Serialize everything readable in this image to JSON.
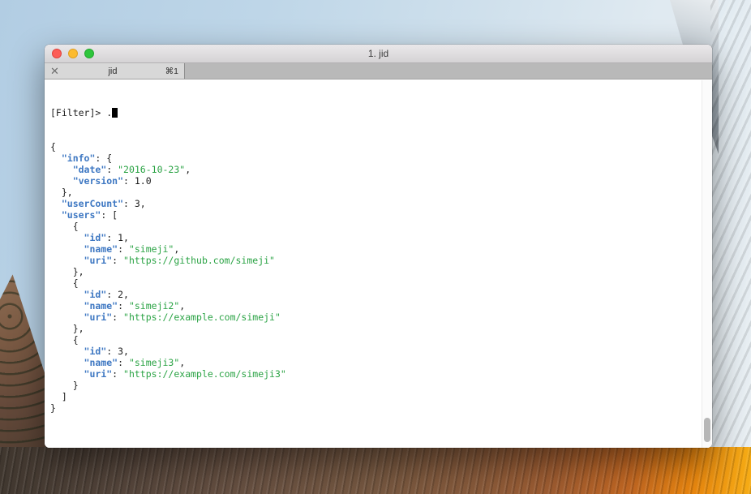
{
  "window": {
    "title": "1. jid",
    "tab": {
      "close_glyph": "✕",
      "title": "jid",
      "shortcut": "⌘1"
    }
  },
  "terminal": {
    "prompt": "[Filter]> ",
    "filter_value": ".",
    "colors": {
      "key": "#3d77c2",
      "string": "#2aa344",
      "plain": "#1c1c1c"
    },
    "json_lines": [
      [
        [
          "p",
          "{"
        ]
      ],
      [
        [
          "p",
          "  "
        ],
        [
          "k",
          "\"info\""
        ],
        [
          "p",
          ": {"
        ]
      ],
      [
        [
          "p",
          "    "
        ],
        [
          "k",
          "\"date\""
        ],
        [
          "p",
          ": "
        ],
        [
          "s",
          "\"2016-10-23\""
        ],
        [
          "p",
          ","
        ]
      ],
      [
        [
          "p",
          "    "
        ],
        [
          "k",
          "\"version\""
        ],
        [
          "p",
          ": 1.0"
        ]
      ],
      [
        [
          "p",
          "  },"
        ]
      ],
      [
        [
          "p",
          "  "
        ],
        [
          "k",
          "\"userCount\""
        ],
        [
          "p",
          ": 3,"
        ]
      ],
      [
        [
          "p",
          "  "
        ],
        [
          "k",
          "\"users\""
        ],
        [
          "p",
          ": ["
        ]
      ],
      [
        [
          "p",
          "    {"
        ]
      ],
      [
        [
          "p",
          "      "
        ],
        [
          "k",
          "\"id\""
        ],
        [
          "p",
          ": 1,"
        ]
      ],
      [
        [
          "p",
          "      "
        ],
        [
          "k",
          "\"name\""
        ],
        [
          "p",
          ": "
        ],
        [
          "s",
          "\"simeji\""
        ],
        [
          "p",
          ","
        ]
      ],
      [
        [
          "p",
          "      "
        ],
        [
          "k",
          "\"uri\""
        ],
        [
          "p",
          ": "
        ],
        [
          "s",
          "\"https://github.com/simeji\""
        ]
      ],
      [
        [
          "p",
          "    },"
        ]
      ],
      [
        [
          "p",
          "    {"
        ]
      ],
      [
        [
          "p",
          "      "
        ],
        [
          "k",
          "\"id\""
        ],
        [
          "p",
          ": 2,"
        ]
      ],
      [
        [
          "p",
          "      "
        ],
        [
          "k",
          "\"name\""
        ],
        [
          "p",
          ": "
        ],
        [
          "s",
          "\"simeji2\""
        ],
        [
          "p",
          ","
        ]
      ],
      [
        [
          "p",
          "      "
        ],
        [
          "k",
          "\"uri\""
        ],
        [
          "p",
          ": "
        ],
        [
          "s",
          "\"https://example.com/simeji\""
        ]
      ],
      [
        [
          "p",
          "    },"
        ]
      ],
      [
        [
          "p",
          "    {"
        ]
      ],
      [
        [
          "p",
          "      "
        ],
        [
          "k",
          "\"id\""
        ],
        [
          "p",
          ": 3,"
        ]
      ],
      [
        [
          "p",
          "      "
        ],
        [
          "k",
          "\"name\""
        ],
        [
          "p",
          ": "
        ],
        [
          "s",
          "\"simeji3\""
        ],
        [
          "p",
          ","
        ]
      ],
      [
        [
          "p",
          "      "
        ],
        [
          "k",
          "\"uri\""
        ],
        [
          "p",
          ": "
        ],
        [
          "s",
          "\"https://example.com/simeji3\""
        ]
      ],
      [
        [
          "p",
          "    }"
        ]
      ],
      [
        [
          "p",
          "  ]"
        ]
      ],
      [
        [
          "p",
          "}"
        ]
      ]
    ]
  }
}
